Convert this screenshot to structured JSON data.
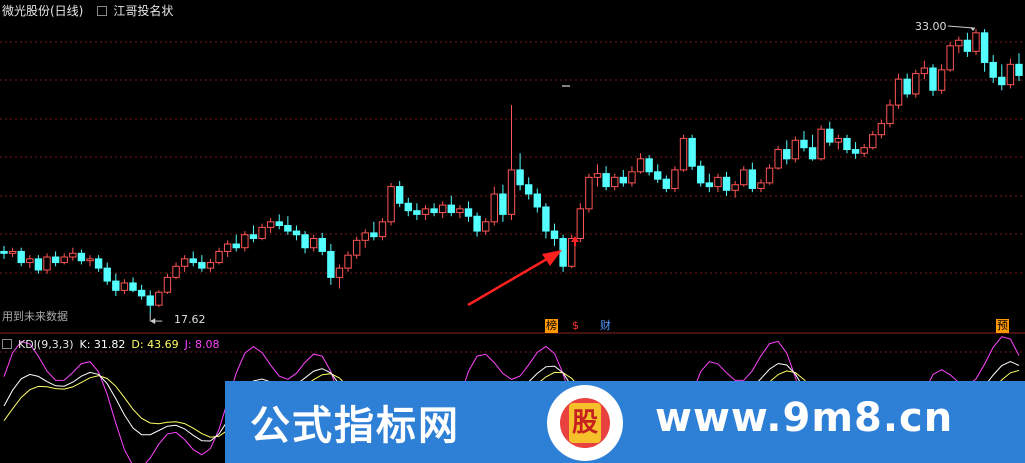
{
  "header": {
    "title": "微光股份(日线)",
    "indicator": "江哥投名状"
  },
  "price_labels": {
    "high": "33.00",
    "low": "17.62"
  },
  "note": "用到未来数据",
  "tags": {
    "bang": "榜",
    "money": "$",
    "cai": "财",
    "yu": "预"
  },
  "kdj": {
    "name": "KDJ(9,3,3)",
    "k": "K: 31.82",
    "d": "D: 43.69",
    "j": "J: 8.08"
  },
  "banner": {
    "left_text": "公式指标网",
    "right_text": "www.9m8.cn",
    "logo_char": "股"
  },
  "colors": {
    "up": "#ff5555",
    "down": "#54ffff",
    "grid": "#7a1a1a",
    "banner": "#2e7fd6",
    "arrow": "#ff2020",
    "k_line": "#ffffff",
    "d_line": "#ffff66",
    "j_line": "#ff44ff"
  },
  "chart_data": {
    "type": "candlestick",
    "high_marker": 33.0,
    "low_marker": 17.62,
    "ohlc": [
      [
        21.0,
        21.3,
        20.6,
        20.9
      ],
      [
        20.9,
        21.2,
        20.7,
        21.0
      ],
      [
        21.0,
        21.2,
        20.2,
        20.4
      ],
      [
        20.4,
        20.8,
        20.1,
        20.6
      ],
      [
        20.6,
        20.8,
        19.8,
        20.0
      ],
      [
        20.0,
        20.9,
        19.8,
        20.7
      ],
      [
        20.7,
        21.0,
        20.2,
        20.4
      ],
      [
        20.4,
        20.9,
        20.3,
        20.7
      ],
      [
        20.7,
        21.2,
        20.5,
        20.9
      ],
      [
        20.9,
        21.1,
        20.3,
        20.5
      ],
      [
        20.5,
        20.8,
        20.2,
        20.6
      ],
      [
        20.6,
        20.8,
        19.9,
        20.1
      ],
      [
        20.1,
        20.4,
        19.2,
        19.4
      ],
      [
        19.4,
        19.8,
        18.6,
        18.9
      ],
      [
        18.9,
        19.5,
        18.7,
        19.3
      ],
      [
        19.3,
        19.6,
        18.8,
        18.9
      ],
      [
        18.9,
        19.2,
        18.4,
        18.6
      ],
      [
        18.6,
        18.9,
        17.62,
        18.1
      ],
      [
        18.1,
        18.9,
        18.0,
        18.8
      ],
      [
        18.8,
        19.8,
        18.7,
        19.6
      ],
      [
        19.6,
        20.4,
        19.5,
        20.2
      ],
      [
        20.2,
        20.8,
        19.9,
        20.6
      ],
      [
        20.6,
        21.0,
        20.2,
        20.4
      ],
      [
        20.4,
        20.8,
        19.9,
        20.1
      ],
      [
        20.1,
        20.6,
        19.9,
        20.4
      ],
      [
        20.4,
        21.2,
        20.3,
        21.0
      ],
      [
        21.0,
        21.6,
        20.7,
        21.4
      ],
      [
        21.4,
        21.9,
        21.0,
        21.2
      ],
      [
        21.2,
        22.1,
        21.0,
        21.9
      ],
      [
        21.9,
        22.4,
        21.5,
        21.7
      ],
      [
        21.7,
        22.5,
        21.6,
        22.3
      ],
      [
        22.3,
        22.8,
        22.0,
        22.6
      ],
      [
        22.6,
        23.0,
        22.2,
        22.4
      ],
      [
        22.4,
        22.9,
        21.9,
        22.1
      ],
      [
        22.1,
        22.4,
        21.6,
        21.9
      ],
      [
        21.9,
        22.1,
        20.9,
        21.2
      ],
      [
        21.2,
        21.9,
        21.0,
        21.7
      ],
      [
        21.7,
        22.0,
        20.8,
        21.0
      ],
      [
        21.0,
        21.4,
        19.2,
        19.6
      ],
      [
        19.6,
        20.3,
        19.0,
        20.1
      ],
      [
        20.1,
        21.0,
        19.9,
        20.8
      ],
      [
        20.8,
        21.8,
        20.6,
        21.6
      ],
      [
        21.6,
        22.2,
        21.2,
        22.0
      ],
      [
        22.0,
        22.6,
        21.6,
        21.8
      ],
      [
        21.8,
        22.8,
        21.6,
        22.6
      ],
      [
        22.6,
        24.7,
        22.4,
        24.5
      ],
      [
        24.5,
        24.8,
        23.4,
        23.6
      ],
      [
        23.6,
        23.9,
        22.9,
        23.2
      ],
      [
        23.2,
        23.6,
        22.7,
        23.0
      ],
      [
        23.0,
        23.5,
        22.7,
        23.3
      ],
      [
        23.3,
        23.6,
        22.9,
        23.1
      ],
      [
        23.1,
        23.7,
        22.8,
        23.5
      ],
      [
        23.5,
        24.0,
        22.9,
        23.1
      ],
      [
        23.1,
        23.5,
        22.8,
        23.3
      ],
      [
        23.3,
        23.7,
        22.6,
        22.9
      ],
      [
        22.9,
        23.1,
        21.8,
        22.1
      ],
      [
        22.1,
        22.8,
        21.9,
        22.6
      ],
      [
        22.6,
        24.5,
        22.4,
        24.1
      ],
      [
        24.1,
        24.6,
        22.6,
        23.0
      ],
      [
        23.0,
        28.9,
        22.7,
        25.4
      ],
      [
        25.4,
        26.3,
        24.3,
        24.6
      ],
      [
        24.6,
        25.0,
        23.8,
        24.1
      ],
      [
        24.1,
        24.4,
        23.1,
        23.4
      ],
      [
        23.4,
        23.6,
        21.7,
        22.1
      ],
      [
        22.1,
        22.5,
        21.3,
        21.7
      ],
      [
        21.7,
        21.9,
        19.9,
        20.2
      ],
      [
        20.2,
        21.9,
        20.1,
        21.7
      ],
      [
        21.7,
        23.6,
        21.5,
        23.3
      ],
      [
        23.3,
        25.2,
        23.1,
        25.0
      ],
      [
        25.0,
        25.7,
        24.5,
        25.2
      ],
      [
        25.2,
        25.6,
        24.3,
        24.5
      ],
      [
        24.5,
        25.2,
        24.3,
        25.0
      ],
      [
        25.0,
        25.4,
        24.5,
        24.7
      ],
      [
        24.7,
        25.6,
        24.5,
        25.3
      ],
      [
        25.3,
        26.3,
        25.2,
        26.0
      ],
      [
        26.0,
        26.2,
        25.1,
        25.3
      ],
      [
        25.3,
        25.7,
        24.7,
        24.9
      ],
      [
        24.9,
        25.1,
        24.2,
        24.4
      ],
      [
        24.4,
        25.6,
        24.2,
        25.4
      ],
      [
        25.4,
        27.3,
        25.3,
        27.1
      ],
      [
        27.1,
        27.3,
        25.4,
        25.6
      ],
      [
        25.6,
        25.9,
        24.5,
        24.7
      ],
      [
        24.7,
        25.2,
        24.2,
        24.5
      ],
      [
        24.5,
        25.2,
        24.2,
        25.0
      ],
      [
        25.0,
        25.3,
        24.0,
        24.3
      ],
      [
        24.3,
        24.8,
        23.9,
        24.6
      ],
      [
        24.6,
        25.6,
        24.5,
        25.4
      ],
      [
        25.4,
        25.8,
        24.2,
        24.4
      ],
      [
        24.4,
        24.9,
        24.2,
        24.7
      ],
      [
        24.7,
        25.7,
        24.6,
        25.5
      ],
      [
        25.5,
        26.7,
        25.4,
        26.5
      ],
      [
        26.5,
        27.0,
        25.7,
        26.0
      ],
      [
        26.0,
        27.2,
        25.8,
        27.0
      ],
      [
        27.0,
        27.5,
        26.4,
        26.6
      ],
      [
        26.6,
        27.3,
        25.9,
        26.0
      ],
      [
        26.0,
        27.8,
        25.9,
        27.6
      ],
      [
        27.6,
        28.0,
        26.7,
        26.9
      ],
      [
        26.9,
        27.3,
        26.5,
        27.1
      ],
      [
        27.1,
        27.3,
        26.3,
        26.5
      ],
      [
        26.5,
        26.9,
        26.0,
        26.3
      ],
      [
        26.3,
        26.8,
        26.1,
        26.6
      ],
      [
        26.6,
        27.5,
        26.5,
        27.3
      ],
      [
        27.3,
        28.1,
        27.1,
        27.9
      ],
      [
        27.9,
        29.2,
        27.7,
        28.9
      ],
      [
        28.9,
        30.6,
        28.7,
        30.3
      ],
      [
        30.3,
        30.6,
        29.3,
        29.5
      ],
      [
        29.5,
        30.8,
        29.3,
        30.6
      ],
      [
        30.6,
        31.3,
        30.3,
        30.9
      ],
      [
        30.9,
        31.1,
        29.4,
        29.7
      ],
      [
        29.7,
        31.1,
        29.5,
        30.8
      ],
      [
        30.8,
        32.3,
        30.7,
        32.1
      ],
      [
        32.1,
        32.6,
        31.7,
        32.4
      ],
      [
        32.4,
        32.8,
        31.5,
        31.8
      ],
      [
        31.8,
        33.0,
        31.6,
        32.8
      ],
      [
        32.8,
        33.0,
        30.7,
        31.2
      ],
      [
        31.2,
        31.6,
        30.1,
        30.4
      ],
      [
        30.4,
        31.1,
        29.7,
        30.0
      ],
      [
        30.0,
        31.4,
        29.8,
        31.1
      ],
      [
        31.1,
        31.7,
        30.2,
        30.5
      ]
    ],
    "kdj": {
      "K": 31.82,
      "D": 43.69,
      "J": 8.08
    }
  }
}
